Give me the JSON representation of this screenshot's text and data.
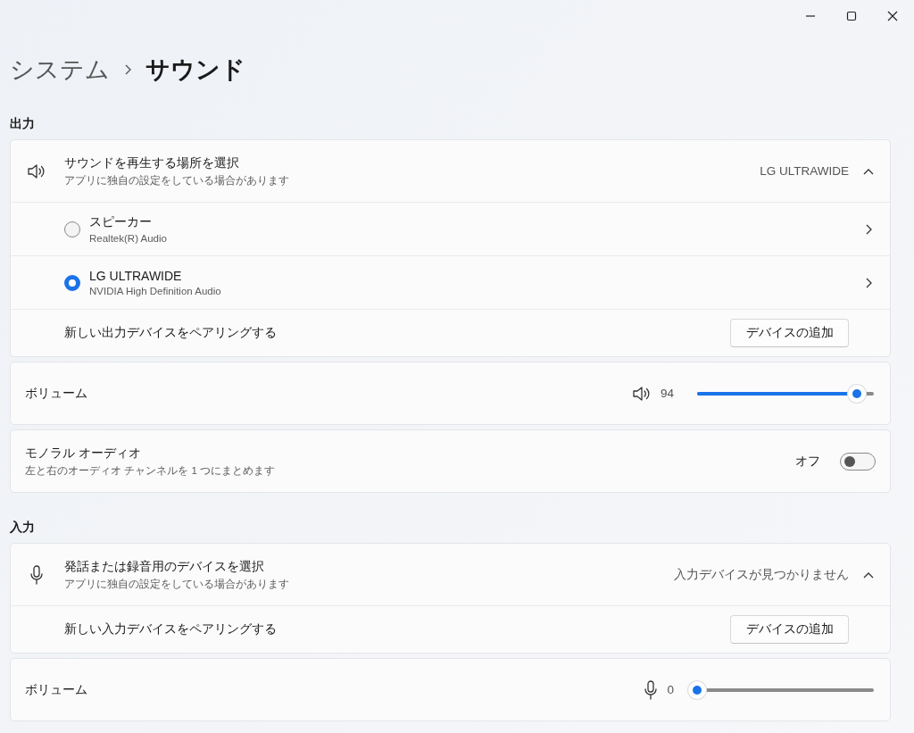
{
  "breadcrumb": {
    "parent": "システム",
    "current": "サウンド"
  },
  "sections": [
    {
      "heading": "出力",
      "cards": [
        {
          "kind": "picker",
          "title": "サウンドを再生する場所を選択",
          "subtitle": "アプリに独自の設定をしている場合があります",
          "value": "LG ULTRAWIDE",
          "expanded": true,
          "devices": [
            {
              "name": "スピーカー",
              "detail": "Realtek(R) Audio",
              "selected": false
            },
            {
              "name": "LG ULTRAWIDE",
              "detail": "NVIDIA High Definition Audio",
              "selected": true
            }
          ],
          "pair_label": "新しい出力デバイスをペアリングする",
          "pair_button": "デバイスの追加"
        },
        {
          "kind": "slider",
          "label": "ボリューム",
          "reading": "94",
          "level": 0.94
        },
        {
          "kind": "toggle",
          "title": "モノラル オーディオ",
          "subtitle": "左と右のオーディオ チャンネルを 1 つにまとめます",
          "state_label": "オフ",
          "on": false
        }
      ]
    },
    {
      "heading": "入力",
      "cards": [
        {
          "kind": "picker",
          "title": "発話または録音用のデバイスを選択",
          "subtitle": "アプリに独自の設定をしている場合があります",
          "value": "入力デバイスが見つかりません",
          "expanded": true,
          "pair_label": "新しい入力デバイスをペアリングする",
          "pair_button": "デバイスの追加"
        },
        {
          "kind": "slider",
          "label": "ボリューム",
          "reading": "0",
          "level": 0
        }
      ]
    }
  ]
}
